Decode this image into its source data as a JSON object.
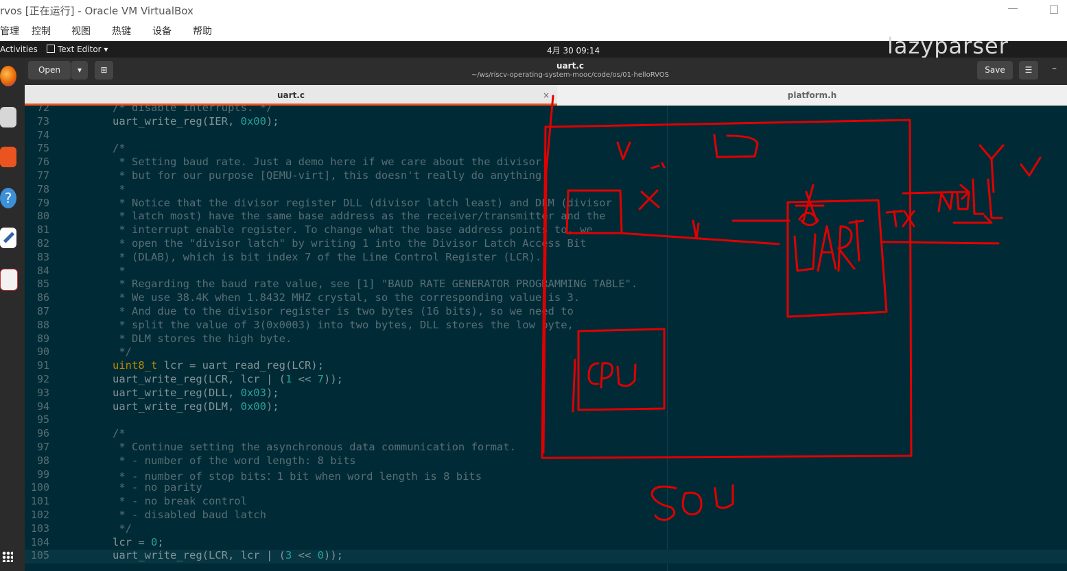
{
  "vbox": {
    "title": "rvos [正在运行] - Oracle VM VirtualBox",
    "menu": [
      "管理",
      "控制",
      "视图",
      "热键",
      "设备",
      "帮助"
    ]
  },
  "topbar": {
    "activities": "Activities",
    "app_menu": "Text Editor ▾",
    "clock": "4月 30  09:14",
    "watermark": "lazyparser"
  },
  "dock": {
    "icons": [
      "firefox-icon",
      "files-icon",
      "software-icon",
      "help-icon",
      "text-editor-icon",
      "notes-icon",
      "apps-grid-icon"
    ]
  },
  "gedit": {
    "open_label": "Open",
    "dropdown_icon": "▾",
    "new_tab_icon": "⊞",
    "title": "uart.c",
    "path": "~/ws/riscv-operating-system-mooc/code/os/01-helloRVOS",
    "save_label": "Save",
    "menu_icon": "☰",
    "minimize_icon": "–"
  },
  "tabs": [
    {
      "label": "uart.c",
      "close": "×"
    },
    {
      "label": "platform.h"
    }
  ],
  "code_lines": [
    {
      "n": "72",
      "text": "/* disable interrupts. */"
    },
    {
      "n": "73",
      "text": "uart_write_reg(IER, 0x00);"
    },
    {
      "n": "74",
      "text": ""
    },
    {
      "n": "75",
      "text": "/*"
    },
    {
      "n": "76",
      "text": " * Setting baud rate. Just a demo here if we care about the divisor,"
    },
    {
      "n": "77",
      "text": " * but for our purpose [QEMU-virt], this doesn't really do anything."
    },
    {
      "n": "78",
      "text": " *"
    },
    {
      "n": "79",
      "text": " * Notice that the divisor register DLL (divisor latch least) and DLM (divisor"
    },
    {
      "n": "80",
      "text": " * latch most) have the same base address as the receiver/transmitter and the"
    },
    {
      "n": "81",
      "text": " * interrupt enable register. To change what the base address points to, we"
    },
    {
      "n": "82",
      "text": " * open the \"divisor latch\" by writing 1 into the Divisor Latch Access Bit"
    },
    {
      "n": "83",
      "text": " * (DLAB), which is bit index 7 of the Line Control Register (LCR)."
    },
    {
      "n": "84",
      "text": " *"
    },
    {
      "n": "85",
      "text": " * Regarding the baud rate value, see [1] \"BAUD RATE GENERATOR PROGRAMMING TABLE\"."
    },
    {
      "n": "86",
      "text": " * We use 38.4K when 1.8432 MHZ crystal, so the corresponding value is 3."
    },
    {
      "n": "87",
      "text": " * And due to the divisor register is two bytes (16 bits), so we need to"
    },
    {
      "n": "88",
      "text": " * split the value of 3(0x0003) into two bytes, DLL stores the low byte,"
    },
    {
      "n": "89",
      "text": " * DLM stores the high byte."
    },
    {
      "n": "90",
      "text": " */"
    },
    {
      "n": "91",
      "kw": "uint8_t",
      "text": " lcr = uart_read_reg(LCR);"
    },
    {
      "n": "92",
      "text": "uart_write_reg(LCR, lcr | (1 << 7));"
    },
    {
      "n": "93",
      "text": "uart_write_reg(DLL, 0x03);"
    },
    {
      "n": "94",
      "text": "uart_write_reg(DLM, 0x00);"
    },
    {
      "n": "95",
      "text": ""
    },
    {
      "n": "96",
      "text": "/*"
    },
    {
      "n": "97",
      "text": " * Continue setting the asynchronous data communication format."
    },
    {
      "n": "98",
      "text": " * - number of the word length: 8 bits"
    },
    {
      "n": "99",
      "text": " * - number of stop bits：1 bit when word length is 8 bits"
    },
    {
      "n": "100",
      "text": " * - no parity"
    },
    {
      "n": "101",
      "text": " * - no break control"
    },
    {
      "n": "102",
      "text": " * - disabled baud latch"
    },
    {
      "n": "103",
      "text": " */"
    },
    {
      "n": "104",
      "text": "lcr = 0;"
    },
    {
      "n": "105",
      "text": "uart_write_reg(LCR, lcr | (3 << 0));"
    }
  ],
  "annotations": {
    "labels": [
      "UART",
      "CPU",
      "TX",
      "SOC",
      "NULL"
    ],
    "color": "#e00000"
  },
  "colors": {
    "editor_bg": "#002b36",
    "comment": "#586e75",
    "keyword": "#b58900",
    "number": "#2aa198",
    "accent": "#e95420"
  }
}
